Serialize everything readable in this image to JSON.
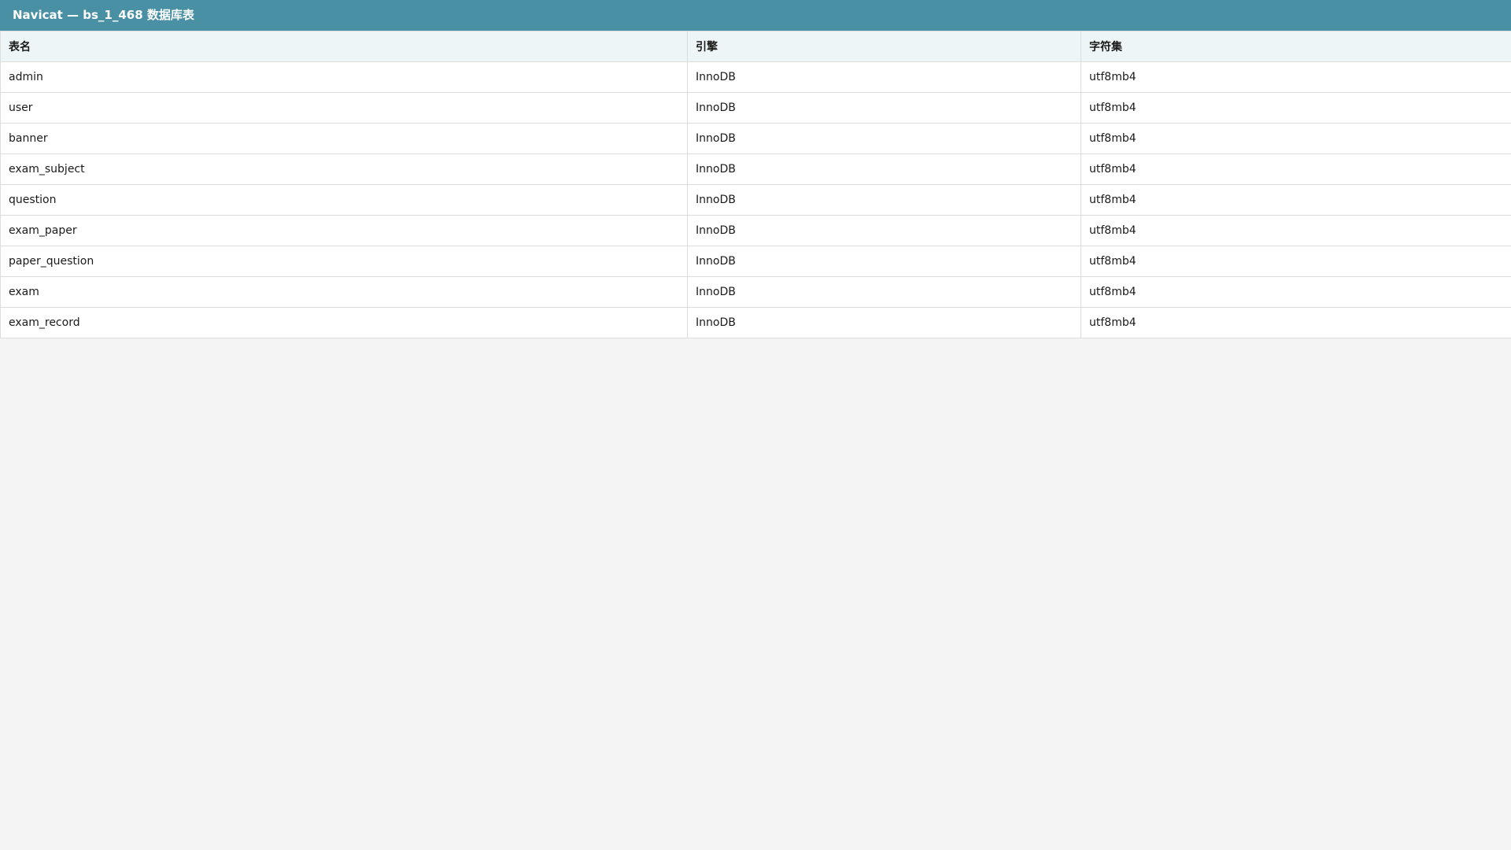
{
  "window": {
    "title": "Navicat — bs_1_468 数据库表"
  },
  "table": {
    "columns": [
      "表名",
      "引擎",
      "字符集"
    ],
    "rows": [
      {
        "name": "admin",
        "engine": "InnoDB",
        "charset": "utf8mb4"
      },
      {
        "name": "user",
        "engine": "InnoDB",
        "charset": "utf8mb4"
      },
      {
        "name": "banner",
        "engine": "InnoDB",
        "charset": "utf8mb4"
      },
      {
        "name": "exam_subject",
        "engine": "InnoDB",
        "charset": "utf8mb4"
      },
      {
        "name": "question",
        "engine": "InnoDB",
        "charset": "utf8mb4"
      },
      {
        "name": "exam_paper",
        "engine": "InnoDB",
        "charset": "utf8mb4"
      },
      {
        "name": "paper_question",
        "engine": "InnoDB",
        "charset": "utf8mb4"
      },
      {
        "name": "exam",
        "engine": "InnoDB",
        "charset": "utf8mb4"
      },
      {
        "name": "exam_record",
        "engine": "InnoDB",
        "charset": "utf8mb4"
      }
    ]
  },
  "colors": {
    "titlebar": "#4a90a4",
    "header_row": "#eef5f7",
    "background": "#f4f4f4"
  }
}
